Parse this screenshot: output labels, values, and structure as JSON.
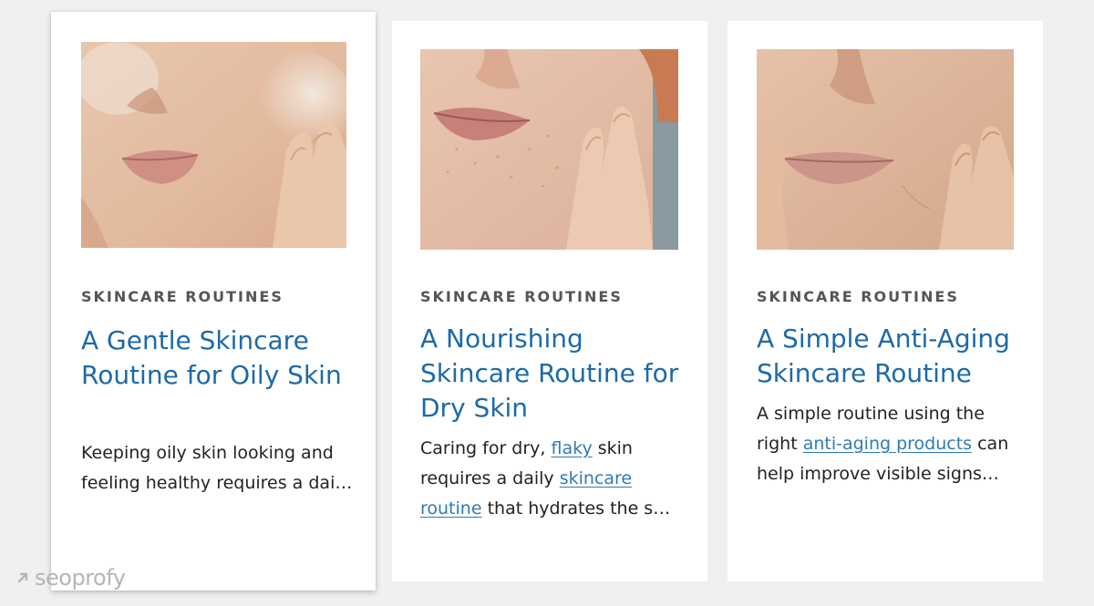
{
  "cards": [
    {
      "image": "face-cleansing-foam-photo",
      "category": "SKINCARE ROUTINES",
      "title": "A Gentle Skincare Routine for Oily Skin",
      "excerpt": {
        "parts": [
          {
            "text": "Keeping oily skin looking and feeling healthy requires a dai…",
            "link": false
          }
        ]
      }
    },
    {
      "image": "freckled-face-touching-cheek-photo",
      "category": "SKINCARE ROUTINES",
      "title": "A Nourishing Skincare Routine for Dry Skin",
      "excerpt": {
        "parts": [
          {
            "text": "Caring for dry, ",
            "link": false
          },
          {
            "text": "flaky",
            "link": true
          },
          {
            "text": " skin requires a daily ",
            "link": false
          },
          {
            "text": "skincare routine",
            "link": true
          },
          {
            "text": " that hydrates the s…",
            "link": false
          }
        ]
      }
    },
    {
      "image": "mature-face-hands-on-cheeks-photo",
      "category": "SKINCARE ROUTINES",
      "title": "A Simple Anti-Aging Skincare Routine",
      "excerpt": {
        "parts": [
          {
            "text": "A simple routine using the right ",
            "link": false
          },
          {
            "text": "anti-aging products",
            "link": true
          },
          {
            "text": " can help improve visible signs…",
            "link": false
          }
        ]
      }
    }
  ],
  "watermark": {
    "text": "seoprofy",
    "icon": "arrow-up-right-icon"
  },
  "colors": {
    "background": "#f0f0f0",
    "card": "#ffffff",
    "category": "#555555",
    "title": "#1d6aa8",
    "link": "#2f7bb4",
    "body_text": "#222222"
  }
}
